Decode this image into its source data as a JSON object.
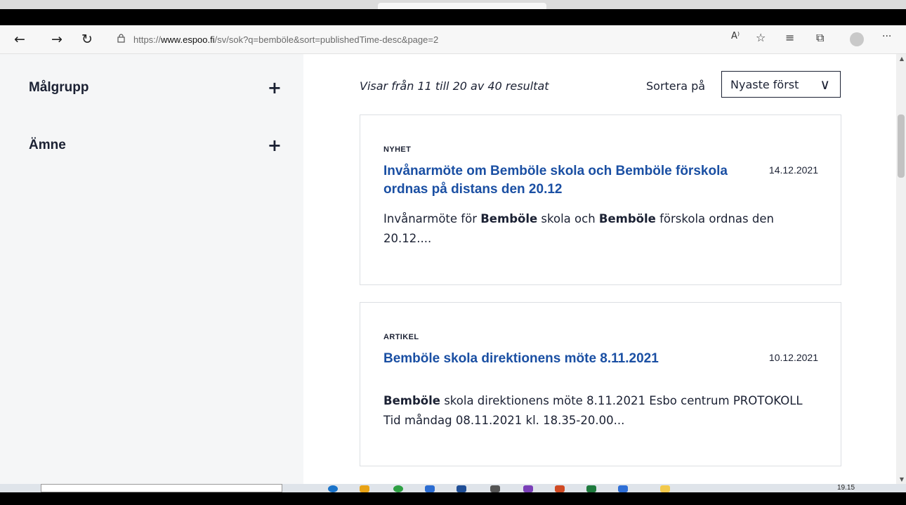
{
  "browser": {
    "url_prefix": "https://",
    "url_host": "www.espoo.fi",
    "url_path": "/sv/sok?q=bemböle&sort=publishedTime-desc&page=2",
    "icons": {
      "back": "←",
      "forward": "→",
      "refresh": "↻",
      "read_aloud": "A⁾",
      "favorite_add": "☆",
      "favorites": "≡",
      "collections": "⧉",
      "more": "···"
    }
  },
  "sidebar": {
    "filters": [
      {
        "label": "Målgrupp",
        "toggle": "+"
      },
      {
        "label": "Ämne",
        "toggle": "+"
      }
    ]
  },
  "results": {
    "summary": "Visar från 11 till 20 av 40 resultat",
    "sort_label": "Sortera på",
    "sort_value": "Nyaste först",
    "sort_chevron": "∨",
    "items": [
      {
        "type": "NYHET",
        "title": "Invånarmöte om Bemböle skola och Bemböle förskola ordnas på distans den 20.12",
        "date": "14.12.2021",
        "excerpt": [
          {
            "t": "Invånarmöte för ",
            "b": false
          },
          {
            "t": "Bemböle",
            "b": true
          },
          {
            "t": " skola och ",
            "b": false
          },
          {
            "t": "Bemböle",
            "b": true
          },
          {
            "t": " förskola ordnas den 20.12....",
            "b": false
          }
        ]
      },
      {
        "type": "ARTIKEL",
        "title": "Bemböle skola direktionens möte 8.11.2021",
        "date": "10.12.2021",
        "excerpt": [
          {
            "t": "Bemböle",
            "b": true
          },
          {
            "t": " skola direktionens möte 8.11.2021 Esbo centrum PROTOKOLL  Tid måndag 08.11.2021 kl. 18.35-20.00...",
            "b": false
          }
        ]
      }
    ]
  },
  "taskbar": {
    "clock_time": "19.15"
  },
  "colors": {
    "link_blue": "#1a4fa3",
    "text_dark": "#1b2133",
    "sidebar_bg": "#f5f6f7",
    "card_border": "#dcdfe3"
  }
}
